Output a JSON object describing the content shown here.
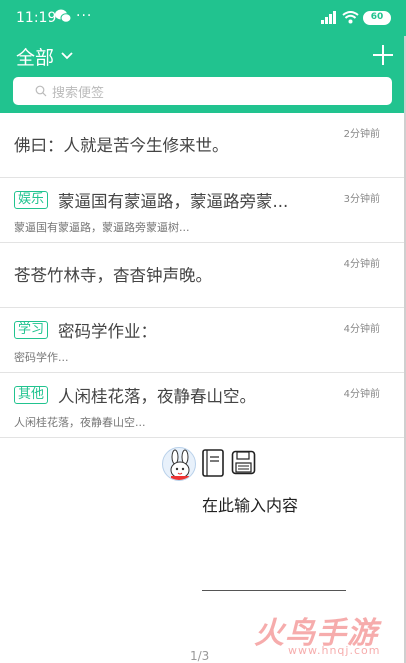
{
  "colors": {
    "accent": "#21c38f",
    "tag_border": "#21c38f"
  },
  "status_bar": {
    "time": "11:19",
    "extra": "···",
    "battery": "60",
    "wechat_icon": "wechat-icon",
    "signal_icon": "signal-icon",
    "wifi_icon": "wifi-icon"
  },
  "header": {
    "folder_label": "全部",
    "dropdown_icon": "chevron-down-icon",
    "add_icon": "plus-icon",
    "search_placeholder": "搜索便签"
  },
  "notes": [
    {
      "tag": "",
      "title": "佛曰：人就是苦今生修来世。",
      "preview": "",
      "time": "2分钟前"
    },
    {
      "tag": "娱乐",
      "title": "蒙逼国有蒙逼路，蒙逼路旁蒙...",
      "preview": "蒙逼国有蒙逼路，蒙逼路旁蒙逼树...",
      "time": "3分钟前"
    },
    {
      "tag": "",
      "title": "苍苍竹林寺，杳杳钟声晚。",
      "preview": "",
      "time": "4分钟前"
    },
    {
      "tag": "学习",
      "title": "密码学作业：",
      "preview": "密码学作...",
      "time": "4分钟前"
    },
    {
      "tag": "其他",
      "title": "人闲桂花落，夜静春山空。",
      "preview": "人闲桂花落，夜静春山空...",
      "time": "4分钟前"
    }
  ],
  "editor": {
    "prompt": "在此输入内容",
    "page_indicator": "1/3",
    "notebook_icon": "notebook-icon",
    "save_icon": "save-icon"
  },
  "watermark": {
    "main": "火鸟手游网",
    "sub": "www.hnqj.com"
  }
}
